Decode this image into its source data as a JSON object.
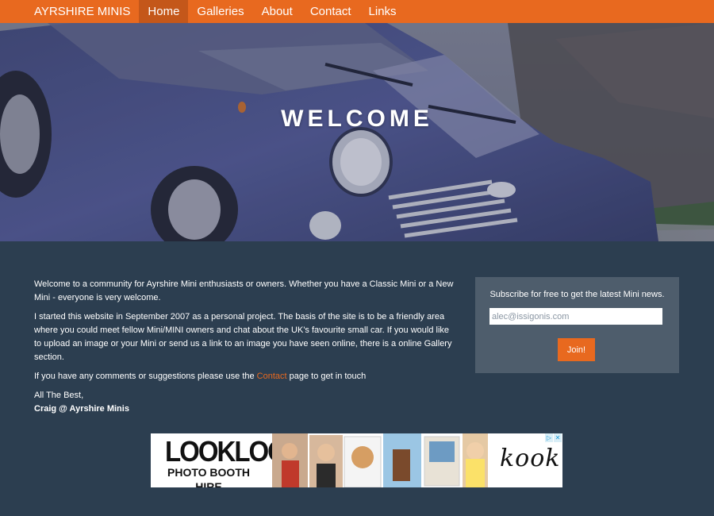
{
  "navbar": {
    "brand": "AYRSHIRE MINIS",
    "items": [
      {
        "label": "Home",
        "active": true
      },
      {
        "label": "Galleries",
        "active": false
      },
      {
        "label": "About",
        "active": false
      },
      {
        "label": "Contact",
        "active": false
      },
      {
        "label": "Links",
        "active": false
      }
    ],
    "color": "#e8691f"
  },
  "hero": {
    "title": "WELCOME"
  },
  "main": {
    "p1": "Welcome to a community for Ayrshire Mini enthusiasts or owners. Whether you have a Classic Mini or a New Mini - everyone is very welcome.",
    "p2": "I started this website in September 2007 as a personal project. The basis of the site is to be a friendly area where you could meet fellow Mini/MINI owners and chat about the UK's favourite small car. If you would like to upload an image or your Mini or send us a link to an image you have seen online, there is a online Gallery section.",
    "p3_before": "If you have any comments or suggestions please use the ",
    "p3_link": "Contact",
    "p3_after": " page to get in touch",
    "signoff": "All The Best,",
    "signoff_name": "Craig @ Ayrshire Minis"
  },
  "subscribe": {
    "text": "Subscribe for free to get the latest Mini news.",
    "email_value": "alec@issigonis.com",
    "button_label": "Join!"
  },
  "ad": {
    "logo_line1": "LOOKLOOK",
    "logo_line2": "PHOTO BOOTH HIRE",
    "brand": "kook",
    "choices_icon": "play-icon",
    "close_icon": "close-icon"
  },
  "colors": {
    "background": "#2c3e50",
    "accent": "#e8691f",
    "panel": "#4e5d6c"
  }
}
